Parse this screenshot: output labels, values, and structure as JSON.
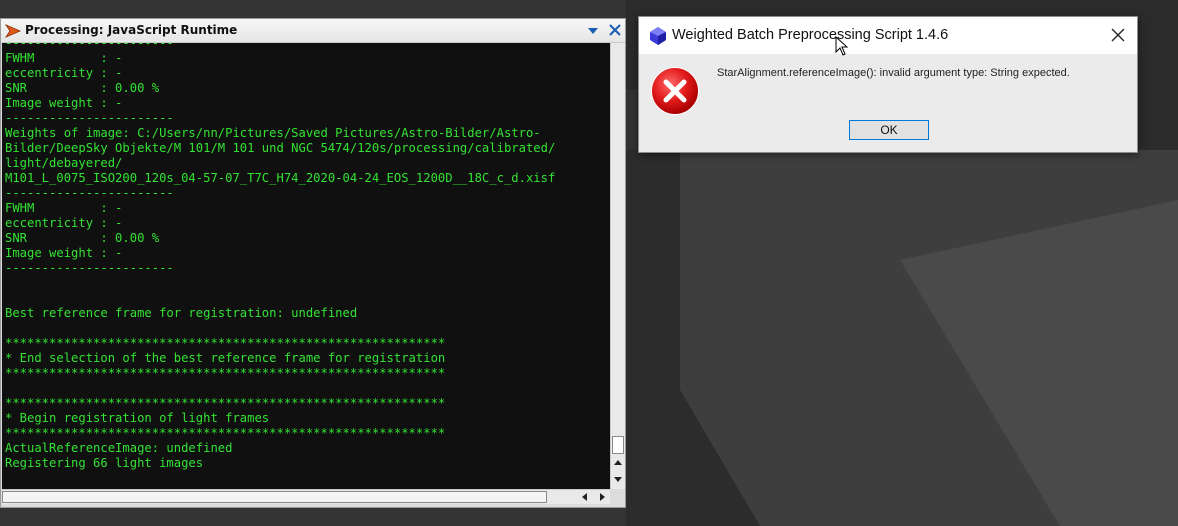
{
  "console": {
    "title": "Processing: JavaScript Runtime",
    "lines": [
      "-----------------------",
      "FWHM         : -",
      "eccentricity : -",
      "SNR          : 0.00 %",
      "Image weight : -",
      "-----------------------",
      "Weights of image: C:/Users/nn/Pictures/Saved Pictures/Astro-Bilder/Astro-",
      "Bilder/DeepSky Objekte/M 101/M 101 und NGC 5474/120s/processing/calibrated/",
      "light/debayered/",
      "M101_L_0075_ISO200_120s_04-57-07_T7C_H74_2020-04-24_EOS_1200D__18C_c_d.xisf",
      "-----------------------",
      "FWHM         : -",
      "eccentricity : -",
      "SNR          : 0.00 %",
      "Image weight : -",
      "-----------------------",
      "",
      "",
      "Best reference frame for registration: undefined",
      "",
      "************************************************************",
      "* End selection of the best reference frame for registration",
      "************************************************************",
      "",
      "************************************************************",
      "* Begin registration of light frames",
      "************************************************************",
      "ActualReferenceImage: undefined",
      "Registering 66 light images"
    ],
    "text_color": "#33e233",
    "background_color": "#101010"
  },
  "dialog": {
    "title": "Weighted Batch Preprocessing Script 1.4.6",
    "message": "StarAlignment.referenceImage(): invalid argument type: String expected.",
    "ok_label": "OK",
    "icon": "error-icon",
    "accent_color": "#0078d7",
    "error_color": "#e81123"
  }
}
